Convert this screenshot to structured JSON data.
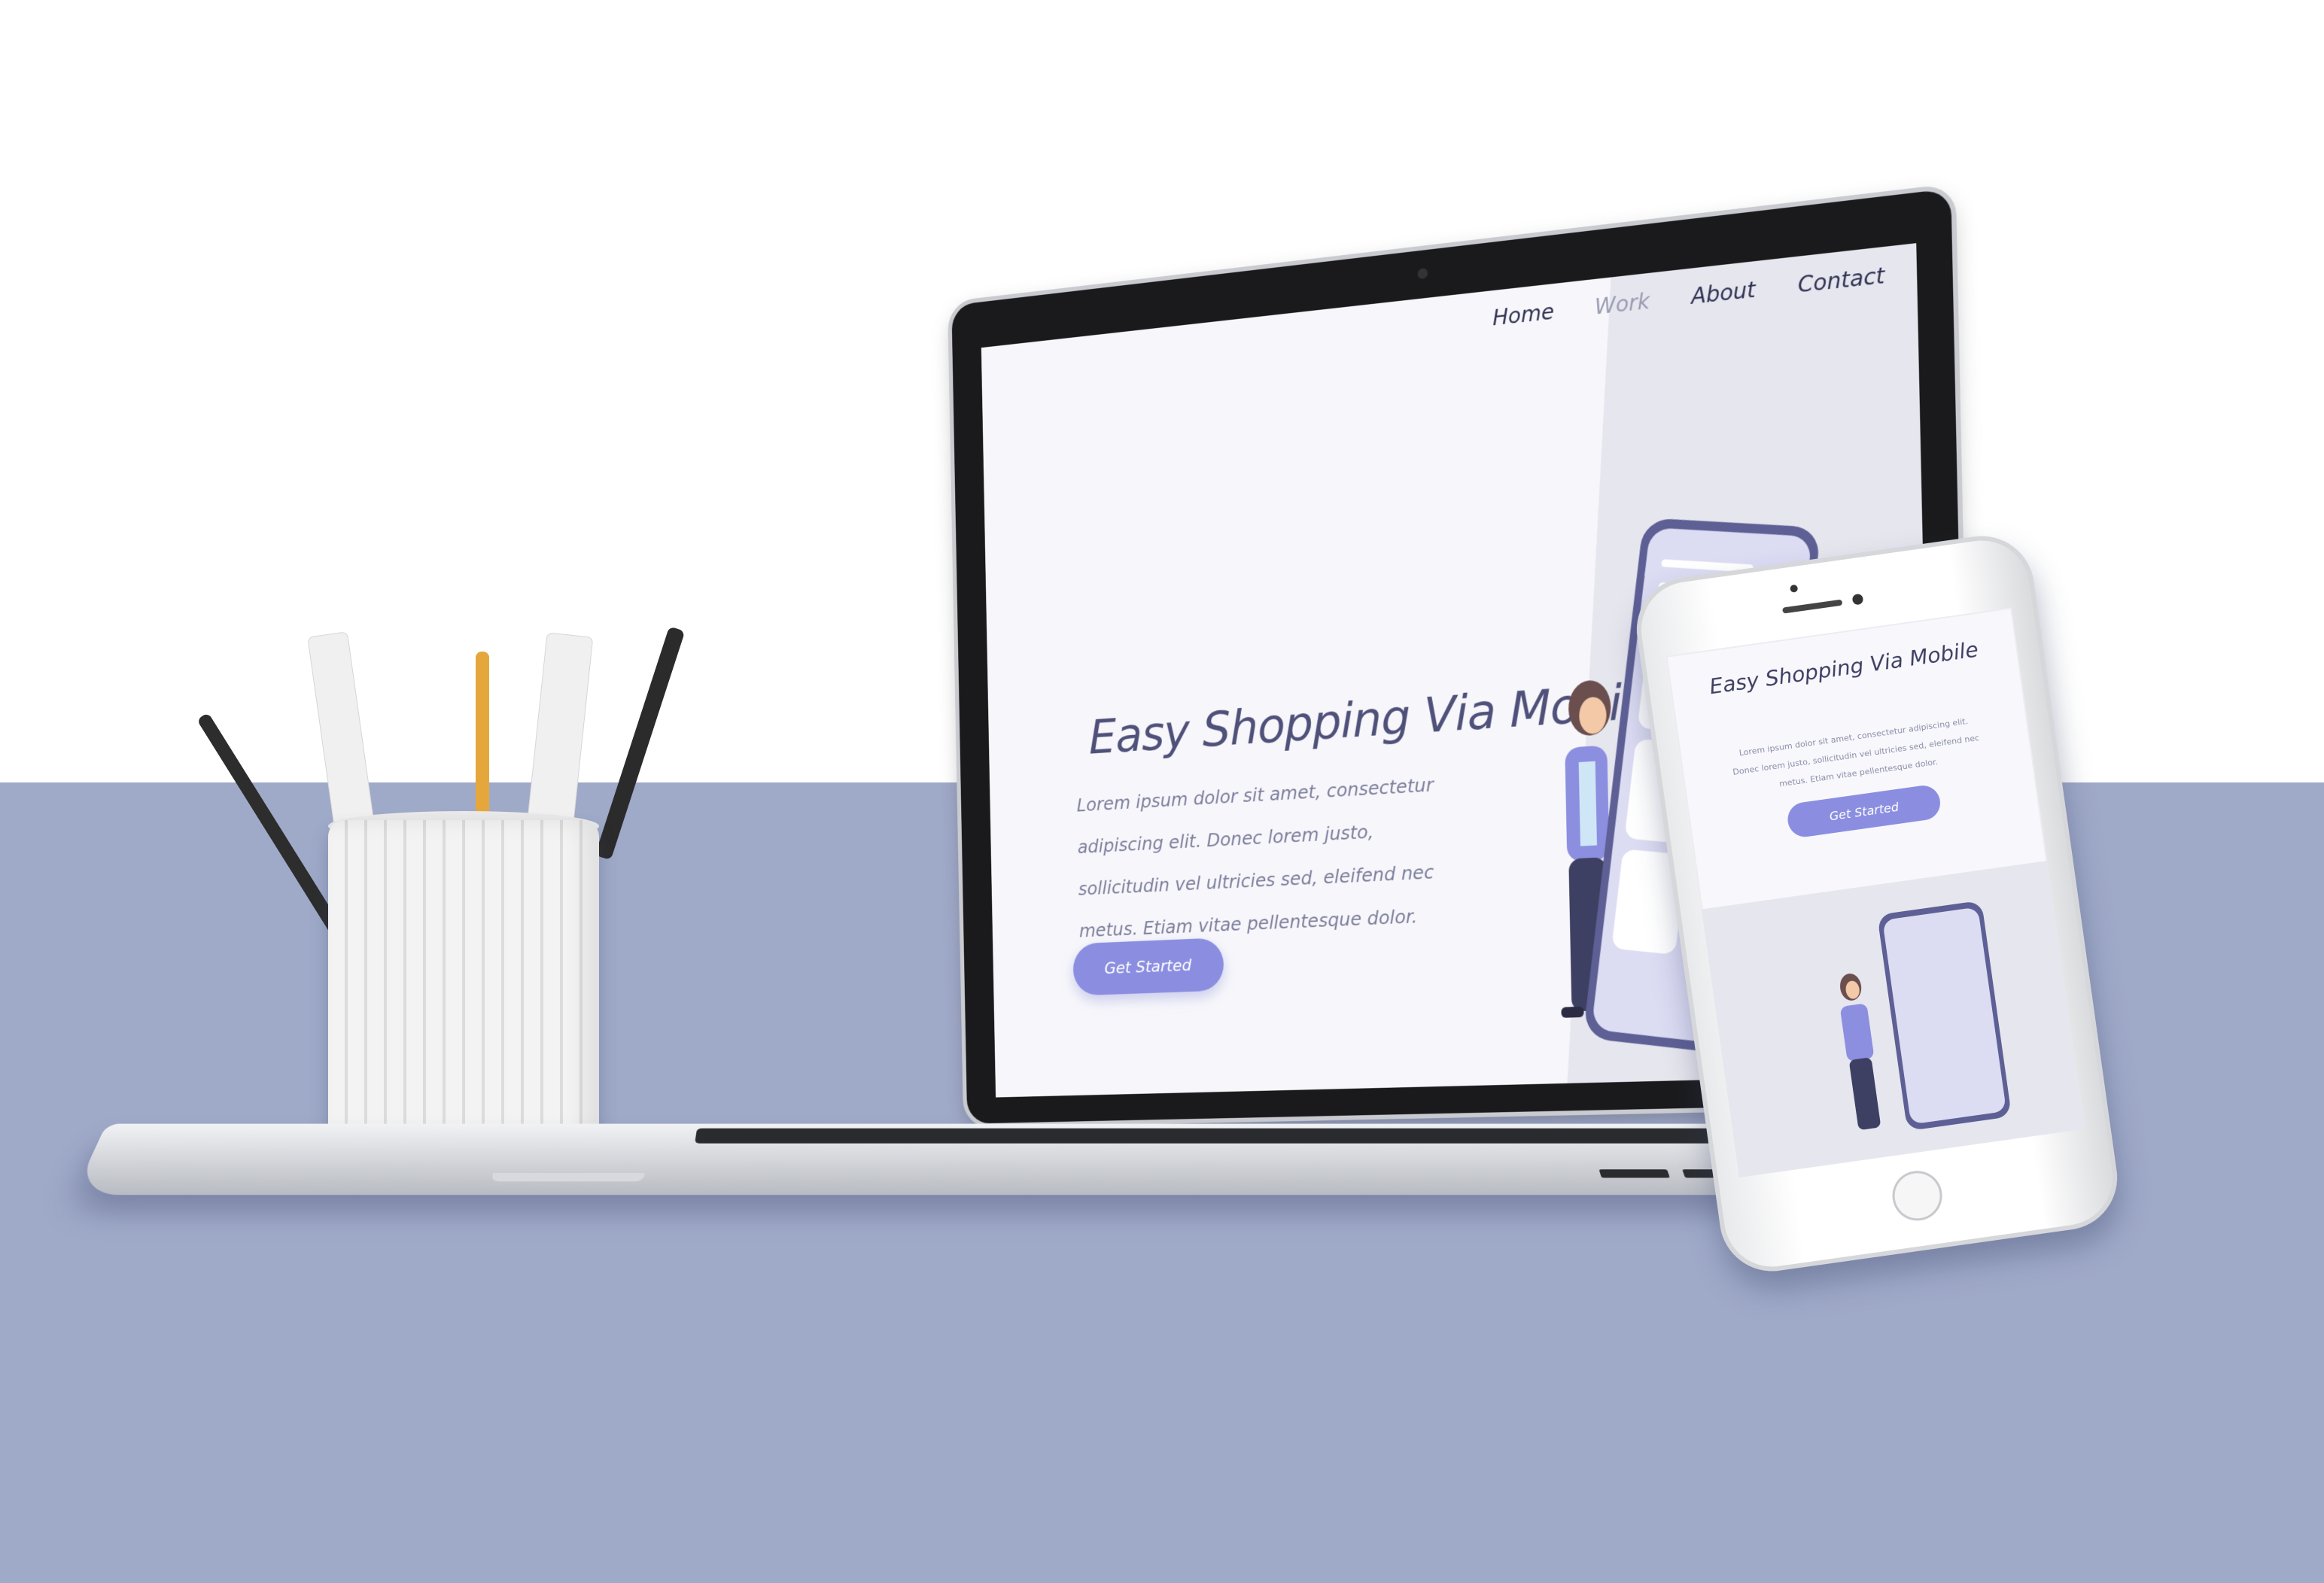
{
  "laptop": {
    "nav": [
      "Home",
      "Work",
      "About",
      "Contact"
    ],
    "hero": {
      "title": "Easy Shopping Via Mobile",
      "body": "Lorem ipsum dolor sit amet, consectetur adipiscing elit. Donec lorem justo, sollicitudin vel ultricies sed, eleifend nec metus. Etiam vitae pellentesque dolor.",
      "cta": "Get Started"
    }
  },
  "phone": {
    "title": "Easy Shopping Via Mobile",
    "body": "Lorem ipsum dolor sit amet, consectetur adipiscing elit. Donec lorem justo, sollicitudin vel ultricies sed, eleifend nec metus. Etiam vitae pellentesque dolor.",
    "cta": "Get Started"
  },
  "colors": {
    "floor": "#9fa9c8",
    "accent": "#8b8ee0",
    "heading": "#4f517a",
    "panel": "#e6e6ee"
  }
}
